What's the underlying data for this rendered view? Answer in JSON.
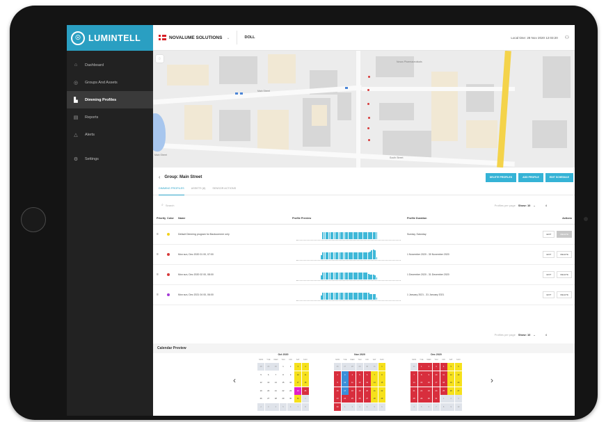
{
  "brand": {
    "logo_mark": "☉",
    "name": "LUMINTELL"
  },
  "topbar": {
    "company": "NOVALUME SOLUTIONS",
    "caret": "⌄",
    "location": "DOLL",
    "local_time": "Local time: 28 Nov 2020 12:03:20",
    "user_icon": "⚇"
  },
  "nav": {
    "items": [
      {
        "icon": "⌂",
        "label": "Dashboard"
      },
      {
        "icon": "◎",
        "label": "Groups And Assets"
      },
      {
        "icon": "▙",
        "label": "Dimming Profiles"
      },
      {
        "icon": "▤",
        "label": "Reports"
      },
      {
        "icon": "△",
        "label": "Alerts"
      },
      {
        "icon": "⚙",
        "label": "Settings"
      }
    ]
  },
  "map": {
    "locate_icon": "◌",
    "street_label_1": "Main Street",
    "street_label_2": "Main Street",
    "place_label": "Novus Pharmaceuticals",
    "road_label": "South Street"
  },
  "group": {
    "back_icon": "‹",
    "title": "Group: Main Street",
    "buttons": [
      "DELETE PROFILES",
      "ADD PROFILE",
      "EDIT SCHEDULE"
    ]
  },
  "tabs": [
    "DIMMING PROFILES",
    "ASSETS (8)",
    "SENSOR ACTIONS"
  ],
  "search": {
    "icon": "⌕",
    "placeholder": "Search"
  },
  "pager": {
    "label": "Profiles per page",
    "show": "Show: 10",
    "caret": "⌄",
    "count": "4"
  },
  "table": {
    "headers": {
      "priority": "Priority",
      "color": "Color",
      "name": "Name",
      "preview": "Profile Preview",
      "duration": "Profile Duration",
      "actions": "Actions"
    },
    "rows": [
      {
        "handle": "≡",
        "name": "Default Dimming program for Backcommer only",
        "duration": "Sunday, Saturday",
        "edit": "EDIT",
        "delete": "DELETE",
        "disabled": true
      },
      {
        "handle": "≡",
        "name": "Mon sun, Dec 2020 01 00, 07:00",
        "duration": "1 November 2020 - 30 November 2020",
        "edit": "EDIT",
        "delete": "DELETE",
        "disabled": false
      },
      {
        "handle": "≡",
        "name": "Mon sun, Dec 2020 02 00, 08:00",
        "duration": "1 December 2020 - 31 December 2020",
        "edit": "EDIT",
        "delete": "DELETE",
        "disabled": false
      },
      {
        "handle": "≡",
        "name": "Mon sun, Dec 2021 04 00, 06:00",
        "duration": "1 January 2021 - 31 January 2021",
        "edit": "EDIT",
        "delete": "DELETE",
        "disabled": false
      }
    ]
  },
  "row_colors": [
    "#f2d21b",
    "#d73a3a",
    "#d73a3a",
    "#a43ad7"
  ],
  "profile_levels": [
    [
      0,
      0,
      0,
      0,
      0,
      0,
      0,
      0,
      0,
      0,
      0,
      0,
      0,
      0,
      0,
      0.7,
      0.7,
      0.7,
      0.7,
      0.7,
      0.7,
      0.7,
      0.7,
      0.7,
      0.7,
      0.7,
      0.7,
      0.7,
      0.7,
      0.7,
      0.7,
      0.7,
      0.7,
      0.7,
      0.7,
      0.7,
      0.7,
      0.7,
      0.7,
      0.7,
      0.7,
      0.7,
      0.7,
      0.7,
      0.7,
      0.7,
      0.7,
      0.7,
      0.7,
      0,
      0,
      0,
      0,
      0,
      0,
      0,
      0,
      0,
      0,
      0
    ],
    [
      0,
      0,
      0,
      0,
      0,
      0,
      0,
      0,
      0,
      0,
      0,
      0,
      0,
      0,
      0.45,
      0.7,
      0.75,
      0.7,
      0.7,
      0.75,
      0.7,
      0.7,
      0.75,
      0.7,
      0.7,
      0.75,
      0.7,
      0.7,
      0.75,
      0.7,
      0.7,
      0.75,
      0.7,
      0.7,
      0.75,
      0.7,
      0.7,
      0.75,
      0.7,
      0.7,
      0.75,
      0.7,
      0.7,
      0.75,
      0.8,
      0.9,
      1,
      0.9,
      0.2,
      0,
      0,
      0,
      0,
      0,
      0,
      0,
      0,
      0,
      0,
      0
    ],
    [
      0,
      0,
      0,
      0,
      0,
      0,
      0,
      0,
      0,
      0,
      0,
      0,
      0,
      0,
      0.4,
      0.75,
      0.7,
      0.7,
      0.75,
      0.7,
      0.7,
      0.75,
      0.7,
      0.7,
      0.75,
      0.7,
      0.7,
      0.75,
      0.7,
      0.7,
      0.75,
      0.7,
      0.7,
      0.75,
      0.7,
      0.7,
      0.75,
      0.7,
      0.7,
      0.75,
      0.7,
      0.7,
      0.75,
      0.55,
      0.5,
      0.5,
      0.5,
      0.45,
      0.2,
      0,
      0,
      0,
      0,
      0,
      0,
      0,
      0,
      0,
      0,
      0
    ],
    [
      0,
      0,
      0,
      0,
      0,
      0,
      0,
      0,
      0,
      0,
      0,
      0,
      0,
      0,
      0.45,
      0.7,
      0.75,
      0.7,
      0.7,
      0.75,
      0.7,
      0.7,
      0.75,
      0.7,
      0.7,
      0.75,
      0.7,
      0.7,
      0.75,
      0.7,
      0.7,
      0.75,
      0.7,
      0.7,
      0.75,
      0.7,
      0.7,
      0.75,
      0.7,
      0.7,
      0.75,
      0.7,
      0.7,
      0.75,
      0.6,
      0.6,
      0.6,
      0.55,
      0.2,
      0,
      0,
      0,
      0,
      0,
      0,
      0,
      0,
      0,
      0,
      0
    ]
  ],
  "pager_bottom": {
    "label": "Profiles per page",
    "show": "Show: 10",
    "caret": "⌄",
    "count": "4"
  },
  "calendar": {
    "title": "Calendar Preview",
    "prev": "‹",
    "next": "›",
    "weekdays": [
      "MON",
      "TUE",
      "WED",
      "THU",
      "FRI",
      "SAT",
      "SUN"
    ],
    "months": [
      {
        "title": "Oct 2020",
        "cells": [
          [
            "28",
            "o"
          ],
          [
            "29",
            "o"
          ],
          [
            "30",
            "o"
          ],
          [
            "1",
            ""
          ],
          [
            "2",
            ""
          ],
          [
            "3",
            "y"
          ],
          [
            "4",
            "y"
          ],
          [
            "5",
            ""
          ],
          [
            "6",
            ""
          ],
          [
            "7",
            ""
          ],
          [
            "8",
            ""
          ],
          [
            "9",
            ""
          ],
          [
            "10",
            "y"
          ],
          [
            "11",
            "y"
          ],
          [
            "12",
            ""
          ],
          [
            "13",
            ""
          ],
          [
            "14",
            ""
          ],
          [
            "15",
            ""
          ],
          [
            "16",
            ""
          ],
          [
            "17",
            "y"
          ],
          [
            "18",
            "y"
          ],
          [
            "19",
            ""
          ],
          [
            "20",
            ""
          ],
          [
            "21",
            ""
          ],
          [
            "22",
            ""
          ],
          [
            "23",
            ""
          ],
          [
            "24",
            "m"
          ],
          [
            "25",
            "r"
          ],
          [
            "26",
            ""
          ],
          [
            "27",
            ""
          ],
          [
            "28",
            ""
          ],
          [
            "29",
            ""
          ],
          [
            "30",
            ""
          ],
          [
            "31",
            "y"
          ],
          [
            "1",
            "o"
          ],
          [
            "2",
            "o"
          ],
          [
            "3",
            "o"
          ],
          [
            "4",
            "o"
          ],
          [
            "5",
            "o"
          ],
          [
            "6",
            "o"
          ],
          [
            "7",
            "o"
          ],
          [
            "8",
            "o"
          ]
        ]
      },
      {
        "title": "Nov 2020",
        "cells": [
          [
            "26",
            "o"
          ],
          [
            "27",
            "o"
          ],
          [
            "28",
            "o"
          ],
          [
            "29",
            "o"
          ],
          [
            "30",
            "o"
          ],
          [
            "31",
            "o"
          ],
          [
            "1",
            "y"
          ],
          [
            "2",
            "r"
          ],
          [
            "3",
            "b"
          ],
          [
            "4",
            "r"
          ],
          [
            "5",
            "r"
          ],
          [
            "6",
            "r"
          ],
          [
            "7",
            "y"
          ],
          [
            "8",
            "y"
          ],
          [
            "9",
            "r"
          ],
          [
            "10",
            "b"
          ],
          [
            "11",
            "r"
          ],
          [
            "12",
            "r"
          ],
          [
            "13",
            "r"
          ],
          [
            "14",
            "y"
          ],
          [
            "15",
            "y"
          ],
          [
            "16",
            "r"
          ],
          [
            "17",
            "b"
          ],
          [
            "18",
            "r"
          ],
          [
            "19",
            "r"
          ],
          [
            "20",
            "r"
          ],
          [
            "21",
            "y"
          ],
          [
            "22",
            "y"
          ],
          [
            "23",
            "r"
          ],
          [
            "24",
            "r"
          ],
          [
            "25",
            "r"
          ],
          [
            "26",
            "r"
          ],
          [
            "27",
            "r"
          ],
          [
            "28",
            "y"
          ],
          [
            "29",
            "y"
          ],
          [
            "30",
            "r"
          ],
          [
            "1",
            "o"
          ],
          [
            "2",
            "o"
          ],
          [
            "3",
            "o"
          ],
          [
            "4",
            "o"
          ],
          [
            "5",
            "o"
          ],
          [
            "6",
            "o"
          ]
        ]
      },
      {
        "title": "Dec 2020",
        "cells": [
          [
            "30",
            "o"
          ],
          [
            "1",
            "r"
          ],
          [
            "2",
            "r"
          ],
          [
            "3",
            "r"
          ],
          [
            "4",
            "r"
          ],
          [
            "5",
            "y"
          ],
          [
            "6",
            "y"
          ],
          [
            "7",
            "r"
          ],
          [
            "8",
            "r"
          ],
          [
            "9",
            "r"
          ],
          [
            "10",
            "r"
          ],
          [
            "11",
            "r"
          ],
          [
            "12",
            "y"
          ],
          [
            "13",
            "y"
          ],
          [
            "14",
            "r"
          ],
          [
            "15",
            "r"
          ],
          [
            "16",
            "r"
          ],
          [
            "17",
            "r"
          ],
          [
            "18",
            "r"
          ],
          [
            "19",
            "y"
          ],
          [
            "20",
            "y"
          ],
          [
            "21",
            "r"
          ],
          [
            "22",
            "r"
          ],
          [
            "23",
            "r"
          ],
          [
            "24",
            "r"
          ],
          [
            "25",
            "r"
          ],
          [
            "26",
            "y"
          ],
          [
            "27",
            "y"
          ],
          [
            "28",
            "r"
          ],
          [
            "29",
            "r"
          ],
          [
            "30",
            "r"
          ],
          [
            "31",
            "r"
          ],
          [
            "1",
            "o"
          ],
          [
            "2",
            "o"
          ],
          [
            "3",
            "o"
          ],
          [
            "4",
            "o"
          ],
          [
            "5",
            "o"
          ],
          [
            "6",
            "o"
          ],
          [
            "7",
            "o"
          ],
          [
            "8",
            "o"
          ],
          [
            "9",
            "o"
          ],
          [
            "10",
            "o"
          ]
        ]
      }
    ]
  }
}
